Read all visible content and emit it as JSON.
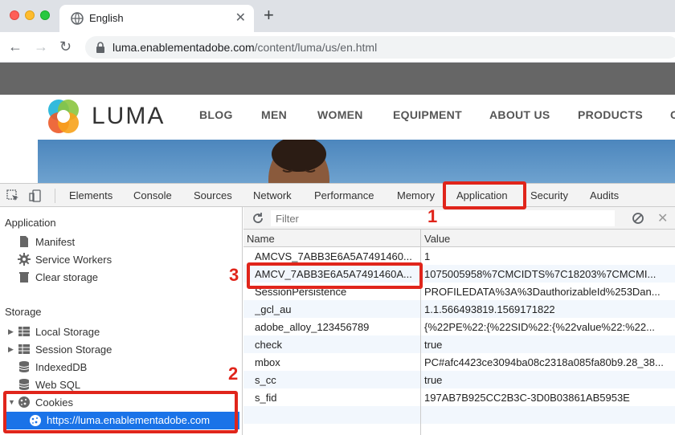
{
  "browser": {
    "tab_title": "English",
    "new_tab": "+",
    "tab_close": "✕",
    "url_host": "luma.enablementadobe.com",
    "url_path": "/content/luma/us/en.html"
  },
  "site": {
    "logo_text": "LUMA",
    "nav": [
      "BLOG",
      "MEN",
      "WOMEN",
      "EQUIPMENT",
      "ABOUT US",
      "PRODUCTS",
      "C"
    ]
  },
  "devtools": {
    "tabs": [
      "Elements",
      "Console",
      "Sources",
      "Network",
      "Performance",
      "Memory",
      "Application",
      "Security",
      "Audits"
    ],
    "active_tab": "Application",
    "sidebar": {
      "application_heading": "Application",
      "application_items": [
        "Manifest",
        "Service Workers",
        "Clear storage"
      ],
      "storage_heading": "Storage",
      "storage_items": [
        "Local Storage",
        "Session Storage",
        "IndexedDB",
        "Web SQL",
        "Cookies"
      ],
      "cookie_url": "https://luma.enablementadobe.com"
    },
    "filter_placeholder": "Filter",
    "table": {
      "headers": [
        "Name",
        "Value"
      ],
      "rows": [
        {
          "name": "AMCVS_7ABB3E6A5A7491460...",
          "value": "1"
        },
        {
          "name": "AMCV_7ABB3E6A5A7491460A...",
          "value": "1075005958%7CMCIDTS%7C18203%7CMCMI..."
        },
        {
          "name": "SessionPersistence",
          "value": "PROFILEDATA%3A%3DauthorizableId%253Dan..."
        },
        {
          "name": "_gcl_au",
          "value": "1.1.566493819.1569171822"
        },
        {
          "name": "adobe_alloy_123456789",
          "value": "{%22PE%22:{%22SID%22:{%22value%22:%22..."
        },
        {
          "name": "check",
          "value": "true"
        },
        {
          "name": "mbox",
          "value": "PC#afc4423ce3094ba08c2318a085fa80b9.28_38..."
        },
        {
          "name": "s_cc",
          "value": "true"
        },
        {
          "name": "s_fid",
          "value": "197AB7B925CC2B3C-3D0B03861AB5953E"
        }
      ]
    }
  },
  "annotations": {
    "one": "1",
    "two": "2",
    "three": "3"
  },
  "colors": {
    "annotation": "#e0251b",
    "selection": "#1a73e8"
  }
}
